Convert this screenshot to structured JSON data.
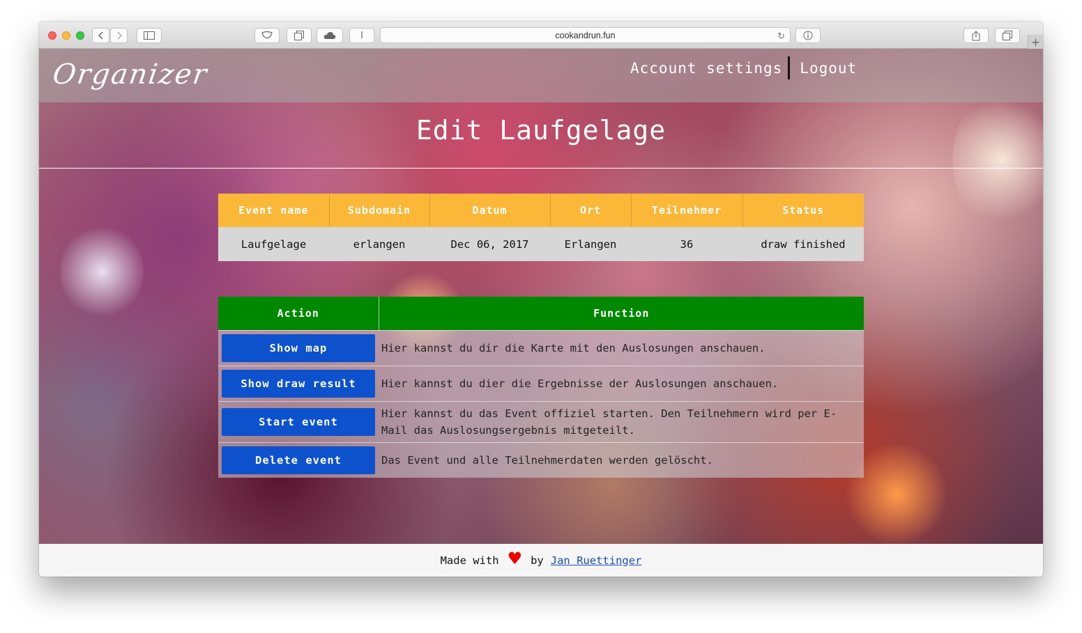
{
  "browser": {
    "url": "cookandrun.fun"
  },
  "navbar": {
    "brand": "Organizer",
    "links": [
      "Account settings",
      "Logout"
    ]
  },
  "page_title": "Edit Laufgelage",
  "event_table": {
    "headers": [
      "Event name",
      "Subdomain",
      "Datum",
      "Ort",
      "Teilnehmer",
      "Status"
    ],
    "row": [
      "Laufgelage",
      "erlangen",
      "Dec 06, 2017",
      "Erlangen",
      "36",
      "draw finished"
    ]
  },
  "action_table": {
    "headers": [
      "Action",
      "Function"
    ],
    "rows": [
      {
        "button": "Show map",
        "description": "Hier kannst du dir die Karte mit den Auslosungen anschauen."
      },
      {
        "button": "Show draw result",
        "description": "Hier kannst du dier die Ergebnisse der Auslosungen anschauen."
      },
      {
        "button": "Start event",
        "description": "Hier kannst du das Event offiziel starten. Den Teilnehmern wird per E-Mail das Auslosungsergebnis mitgeteilt."
      },
      {
        "button": "Delete event",
        "description": "Das Event und alle Teilnehmerdaten werden gelöscht."
      }
    ]
  },
  "footer": {
    "prefix": "Made with",
    "heart": "♥",
    "by": "by",
    "author": "Jan Ruettinger"
  },
  "colors": {
    "header_orange": "#fab738",
    "header_green": "#008800",
    "button_blue": "#0d52cc",
    "heart_red": "#ee0000"
  }
}
